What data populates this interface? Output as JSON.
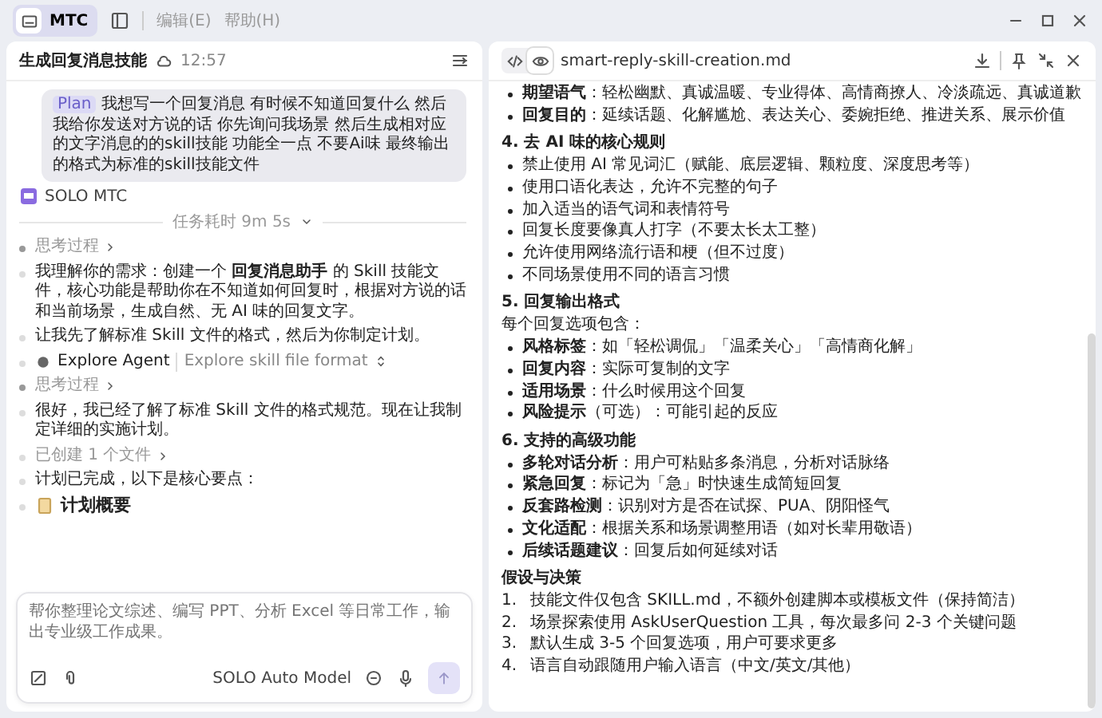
{
  "window": {
    "badge": "MTC",
    "menus": [
      {
        "label": "编辑(E)",
        "disabled": true
      },
      {
        "label": "帮助(H)",
        "disabled": true
      }
    ]
  },
  "chat": {
    "title": "生成回复消息技能",
    "time": "12:57",
    "user_message": {
      "badge": "Plan",
      "text": "我想写一个回复消息 有时候不知道回复什么 然后我给你发送对方说的话 你先询问我场景 然后生成相对应的文字消息的的skill技能 功能全一点 不要Ai味 最终输出的格式为标准的skill技能文件"
    },
    "agent_name": "SOLO MTC",
    "duration": "任务耗时 9m 5s",
    "stream": [
      {
        "kind": "thinking",
        "text": "思考过程"
      },
      {
        "kind": "paragraph",
        "text": "我理解你的需求：创建一个 **回复消息助手** 的 Skill 技能文件，核心功能是帮助你在不知道如何回复时，根据对方说的话和当前场景，生成自然、无 AI 味的回复文字。"
      },
      {
        "kind": "paragraph",
        "text": "让我先了解标准 Skill 文件的格式，然后为你制定计划。"
      },
      {
        "kind": "agent",
        "text": "Explore Agent",
        "task": "Explore skill file format"
      },
      {
        "kind": "thinking",
        "text": "思考过程"
      },
      {
        "kind": "paragraph",
        "text": "很好，我已经了解了标准 Skill 文件的格式规范。现在让我制定详细的实施计划。"
      },
      {
        "kind": "files",
        "text": "已创建 1 个文件"
      },
      {
        "kind": "paragraph",
        "text": "计划已完成，以下是核心要点："
      },
      {
        "kind": "heading",
        "text": "计划概要"
      }
    ],
    "composer": {
      "placeholder": "帮你整理论文综述、编写 PPT、分析 Excel 等日常工作，输出专业级工作成果。",
      "model": "SOLO Auto Model"
    }
  },
  "document": {
    "view_modes": [
      {
        "kind": "code",
        "selected": false
      },
      {
        "kind": "preview",
        "selected": true
      }
    ],
    "filename": "smart-reply-skill-creation.md",
    "blocks": [
      {
        "kind": "bullet",
        "text": "**期望语气**：轻松幽默、真诚温暖、专业得体、高情商撩人、冷淡疏远、真诚道歉"
      },
      {
        "kind": "bullet",
        "text": "**回复目的**：延续话题、化解尴尬、表达关心、委婉拒绝、推进关系、展示价值"
      },
      {
        "kind": "heading",
        "text": "4. 去 AI 味的核心规则"
      },
      {
        "kind": "bullet",
        "text": "禁止使用 AI 常见词汇（赋能、底层逻辑、颗粒度、深度思考等）"
      },
      {
        "kind": "bullet",
        "text": "使用口语化表达，允许不完整的句子"
      },
      {
        "kind": "bullet",
        "text": "加入适当的语气词和表情符号"
      },
      {
        "kind": "bullet",
        "text": "回复长度要像真人打字（不要太长太工整）"
      },
      {
        "kind": "bullet",
        "text": "允许使用网络流行语和梗（但不过度）"
      },
      {
        "kind": "bullet",
        "text": "不同场景使用不同的语言习惯"
      },
      {
        "kind": "heading",
        "text": "5. 回复输出格式"
      },
      {
        "kind": "paragraph",
        "text": "每个回复选项包含："
      },
      {
        "kind": "bullet",
        "text": "**风格标签**：如「轻松调侃」「温柔关心」「高情商化解」"
      },
      {
        "kind": "bullet",
        "text": "**回复内容**：实际可复制的文字"
      },
      {
        "kind": "bullet",
        "text": "**适用场景**：什么时候用这个回复"
      },
      {
        "kind": "bullet",
        "text": "**风险提示**（可选）：可能引起的反应"
      },
      {
        "kind": "heading",
        "text": "6. 支持的高级功能"
      },
      {
        "kind": "bullet",
        "text": "**多轮对话分析**：用户可粘贴多条消息，分析对话脉络"
      },
      {
        "kind": "bullet",
        "text": "**紧急回复**：标记为「急」时快速生成简短回复"
      },
      {
        "kind": "bullet",
        "text": "**反套路检测**：识别对方是否在试探、PUA、阴阳怪气"
      },
      {
        "kind": "bullet",
        "text": "**文化适配**：根据关系和场景调整用语（如对长辈用敬语）"
      },
      {
        "kind": "bullet",
        "text": "**后续话题建议**：回复后如何延续对话"
      },
      {
        "kind": "heading",
        "text": "假设与决策"
      },
      {
        "kind": "numbered",
        "number": "1.",
        "text": "技能文件仅包含 SKILL.md，不额外创建脚本或模板文件（保持简洁）"
      },
      {
        "kind": "numbered",
        "number": "2.",
        "text": "场景探索使用 AskUserQuestion 工具，每次最多问 2-3 个关键问题"
      },
      {
        "kind": "numbered",
        "number": "3.",
        "text": "默认生成 3-5 个回复选项，用户可要求更多"
      },
      {
        "kind": "numbered",
        "number": "4.",
        "text": "语言自动跟随用户输入语言（中文/英文/其他）"
      }
    ]
  }
}
